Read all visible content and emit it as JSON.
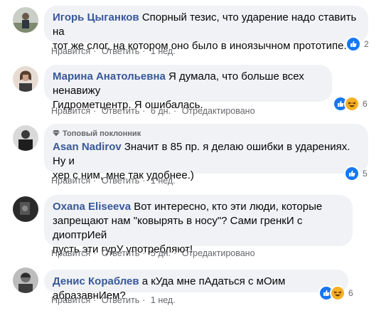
{
  "comments": [
    {
      "author": "Игорь Цыганков",
      "text_line1": "Спорный тезис, что ударение надо ставить на",
      "text_line2": "тот же слог, на котором оно было в иноязычном прототипе.",
      "actions": [
        "Нравится",
        "Ответить",
        "1 нед."
      ],
      "reactions": [
        "like"
      ],
      "reaction_count": "2"
    },
    {
      "author": "Марина Анатольевна",
      "text_line1": "Я думала, что больше всех ненавижу",
      "text_line2": "Гидрометцентр. Я ошибалась.",
      "actions": [
        "Нравится",
        "Ответить",
        "6 дн.",
        "Отредактировано"
      ],
      "reactions": [
        "like",
        "haha"
      ],
      "reaction_count": "6"
    },
    {
      "badge": "Топовый поклонник",
      "author": "Asan Nadirov",
      "text_line1": "Значит в 85 пр. я делаю ошибки в ударениях. Ну и",
      "text_line2": "хер с ним, мне так удобнее.)",
      "actions": [
        "Нравится",
        "Ответить",
        "1 нед."
      ],
      "reactions": [
        "like"
      ],
      "reaction_count": "5"
    },
    {
      "author": "Oxana Eliseeva",
      "text_line1": "Вот интересно, кто эти люди, которые",
      "text_line2": "запрещают нам \"ковырять в носу\"? Сами гренкИ с диоптрИей",
      "text_line3": "пусть эти гурУ употребляют!",
      "actions": [
        "Нравится",
        "Ответить",
        "5 дн.",
        "Отредактировано"
      ]
    },
    {
      "author": "Денис Кораблев",
      "text_line1": "а кУда мне пАдаться с мОим абразавнИем?",
      "actions": [
        "Нравится",
        "Ответить",
        "1 нед."
      ],
      "reactions": [
        "like",
        "haha"
      ],
      "reaction_count": "6"
    }
  ],
  "colors": {
    "author": "#385898",
    "bubble": "#f0f2f5",
    "meta": "#65676b",
    "like": "#1877f2",
    "haha": "#f7b125"
  }
}
